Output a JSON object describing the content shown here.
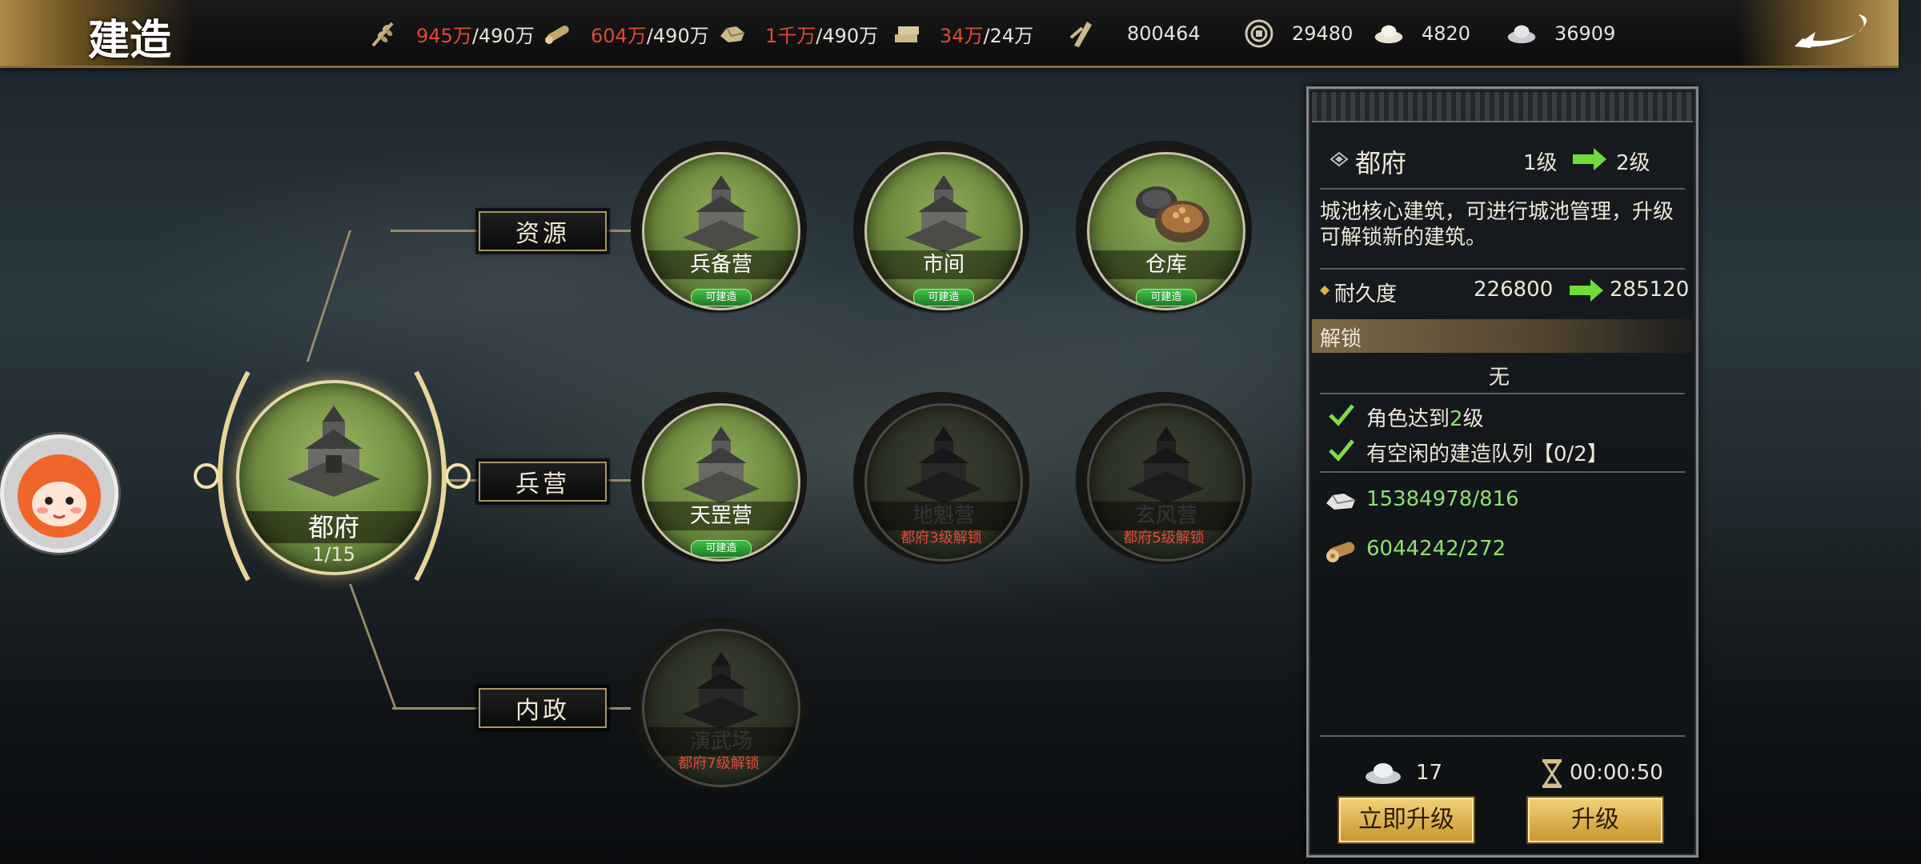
{
  "header": {
    "title": "建造",
    "resources": [
      {
        "icon": "grain-icon",
        "current": "945万",
        "max": "/490万"
      },
      {
        "icon": "wood-icon",
        "current": "604万",
        "max": "/490万"
      },
      {
        "icon": "stone-icon",
        "current": "1千万",
        "max": "/490万"
      },
      {
        "icon": "iron-icon",
        "current": "34万",
        "max": "/24万"
      },
      {
        "icon": "decree-icon",
        "value": "800464"
      },
      {
        "icon": "copper-coin-icon",
        "value": "29480"
      },
      {
        "icon": "gold-ingot-icon",
        "value": "4820"
      },
      {
        "icon": "silver-ingot-icon",
        "value": "36909"
      }
    ]
  },
  "tree": {
    "main": {
      "name": "都府",
      "level": "1/15"
    },
    "categories": [
      "资源",
      "兵营",
      "内政"
    ],
    "nodes": [
      {
        "name": "兵备营",
        "status": "可建造",
        "locked": false
      },
      {
        "name": "市间",
        "status": "可建造",
        "locked": false
      },
      {
        "name": "仓库",
        "status": "可建造",
        "locked": false
      },
      {
        "name": "天罡营",
        "status": "可建造",
        "locked": false
      },
      {
        "name": "地魁营",
        "status": "都府3级解锁",
        "locked": true
      },
      {
        "name": "玄风营",
        "status": "都府5级解锁",
        "locked": true
      },
      {
        "name": "演武场",
        "status": "都府7级解锁",
        "locked": true
      }
    ]
  },
  "panel": {
    "building_name": "都府",
    "level_from": "1级",
    "level_to": "2级",
    "description": "城池核心建筑，可进行城池管理，升级可解锁新的建筑。",
    "durability_label": "耐久度",
    "durability_from": "226800",
    "durability_to": "285120",
    "unlock_header": "解锁",
    "unlock_value": "无",
    "req1_prefix": "角色达到",
    "req1_level": "2",
    "req1_suffix": "级",
    "req2": "有空闲的建造队列【0/2】",
    "cost_stone": "15384978/816",
    "cost_wood": "6044242/272",
    "instant_cost": "17",
    "time": "00:00:50",
    "btn_instant": "立即升级",
    "btn_upgrade": "升级"
  },
  "colors": {
    "accent_gold": "#d8b46a",
    "resource_over": "#e24a32",
    "ok_green": "#8fe06f",
    "lock_red": "#e04a3a"
  }
}
